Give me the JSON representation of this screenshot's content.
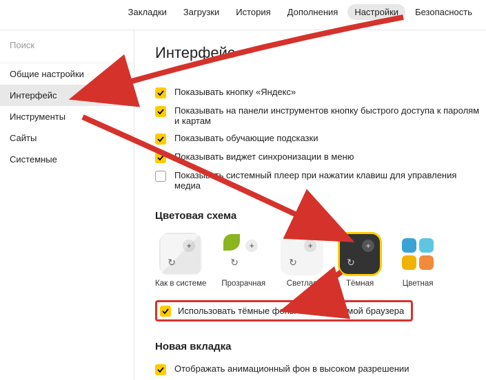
{
  "topnav": {
    "items": [
      "Закладки",
      "Загрузки",
      "История",
      "Дополнения",
      "Настройки",
      "Безопасность"
    ],
    "active_index": 4
  },
  "sidebar": {
    "search_placeholder": "Поиск",
    "items": [
      "Общие настройки",
      "Интерфейс",
      "Инструменты",
      "Сайты",
      "Системные"
    ],
    "active_index": 1
  },
  "page": {
    "title": "Интерфейс",
    "general_checks": [
      {
        "checked": true,
        "label": "Показывать кнопку «Яндекс»"
      },
      {
        "checked": true,
        "label": "Показывать на панели инструментов кнопку быстрого доступа к паролям и картам"
      },
      {
        "checked": true,
        "label": "Показывать обучающие подсказки"
      },
      {
        "checked": true,
        "label": "Показывать виджет синхронизации в меню"
      },
      {
        "checked": false,
        "label": "Показывать системный плеер при нажатии клавиш для управления медиа"
      }
    ],
    "color_scheme": {
      "heading": "Цветовая схема",
      "themes": [
        {
          "key": "system",
          "label": "Как в системе"
        },
        {
          "key": "transparent",
          "label": "Прозрачная"
        },
        {
          "key": "light",
          "label": "Светлая"
        },
        {
          "key": "dark",
          "label": "Тёмная"
        },
        {
          "key": "color",
          "label": "Цветная"
        }
      ],
      "selected_index": 3,
      "dark_bg_check": {
        "checked": true,
        "label": "Использовать тёмные фоны с тёмной темой браузера"
      }
    },
    "new_tab": {
      "heading": "Новая вкладка",
      "checks": [
        {
          "checked": true,
          "label": "Отображать анимационный фон в высоком разрешении"
        }
      ]
    }
  }
}
